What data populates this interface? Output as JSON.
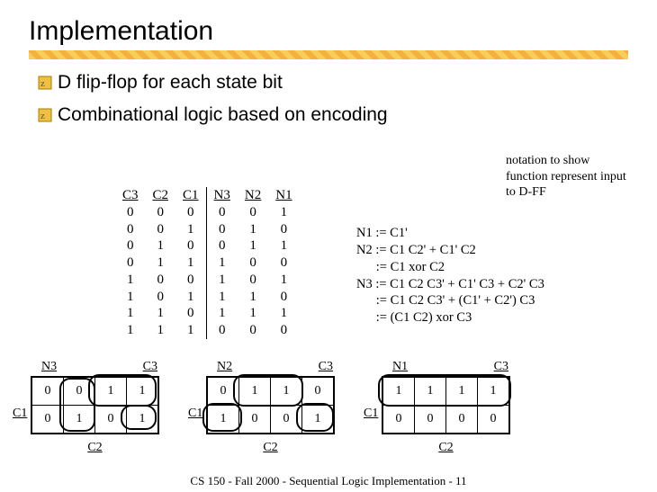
{
  "title": "Implementation",
  "bullets": [
    "D flip-flop for each state bit",
    "Combinational logic based on encoding"
  ],
  "truth_table": {
    "headers": [
      "C3",
      "C2",
      "C1",
      "N3",
      "N2",
      "N1"
    ],
    "rows": [
      [
        "0",
        "0",
        "0",
        "0",
        "0",
        "1"
      ],
      [
        "0",
        "0",
        "1",
        "0",
        "1",
        "0"
      ],
      [
        "0",
        "1",
        "0",
        "0",
        "1",
        "1"
      ],
      [
        "0",
        "1",
        "1",
        "1",
        "0",
        "0"
      ],
      [
        "1",
        "0",
        "0",
        "1",
        "0",
        "1"
      ],
      [
        "1",
        "0",
        "1",
        "1",
        "1",
        "0"
      ],
      [
        "1",
        "1",
        "0",
        "1",
        "1",
        "1"
      ],
      [
        "1",
        "1",
        "1",
        "0",
        "0",
        "0"
      ]
    ]
  },
  "note": "notation to show function represent input to D-FF",
  "equations": "N1 := C1'\nN2 := C1 C2' + C1' C2\n      := C1 xor C2\nN3 := C1 C2 C3' + C1' C3 + C2' C3\n      := C1 C2 C3' + (C1' + C2') C3\n      := (C1 C2) xor C3",
  "kmaps": [
    {
      "name": "N3",
      "top": "C3",
      "left": "C1",
      "bottom": "C2",
      "cells": [
        [
          "0",
          "0",
          "1",
          "1"
        ],
        [
          "0",
          "1",
          "0",
          "1"
        ]
      ]
    },
    {
      "name": "N2",
      "top": "C3",
      "left": "C1",
      "bottom": "C2",
      "cells": [
        [
          "0",
          "1",
          "1",
          "0"
        ],
        [
          "1",
          "0",
          "0",
          "1"
        ]
      ]
    },
    {
      "name": "N1",
      "top": "C3",
      "left": "C1",
      "bottom": "C2",
      "cells": [
        [
          "1",
          "1",
          "1",
          "1"
        ],
        [
          "0",
          "0",
          "0",
          "0"
        ]
      ]
    }
  ],
  "footer": "CS 150 - Fall 2000 - Sequential Logic Implementation - 11"
}
